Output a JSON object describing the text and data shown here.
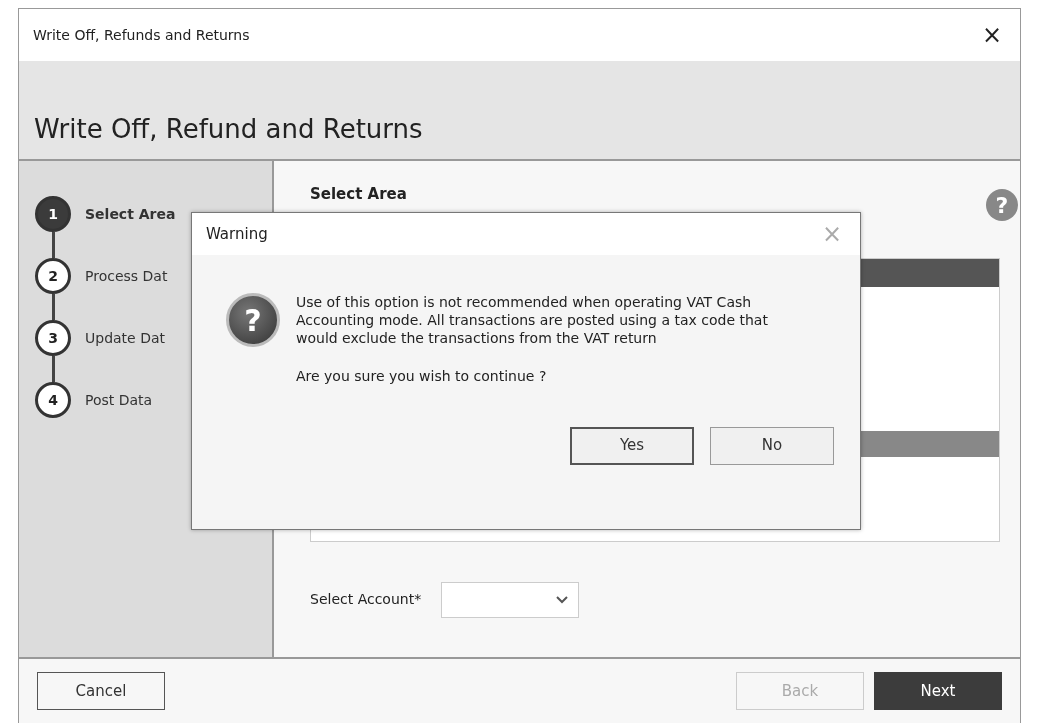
{
  "window": {
    "title": "Write Off, Refunds and Returns",
    "close": "×"
  },
  "header": {
    "title": "Write Off, Refund and Returns"
  },
  "steps": [
    {
      "number": "1",
      "label": "Select Area",
      "selected": true
    },
    {
      "number": "2",
      "label": "Process Dat",
      "selected": false
    },
    {
      "number": "3",
      "label": "Update Dat",
      "selected": false
    },
    {
      "number": "4",
      "label": "Post Data",
      "selected": false
    }
  ],
  "content": {
    "heading": "Select Area",
    "help": "?",
    "account_label": "Select Account*"
  },
  "footer": {
    "buttons": [
      {
        "label": "Cancel",
        "kind": "cancel",
        "disabled": false
      },
      {
        "label": "Back",
        "kind": "back",
        "disabled": true
      },
      {
        "label": "Next",
        "kind": "next",
        "disabled": false
      }
    ]
  },
  "dialog": {
    "title": "Warning",
    "close": "×",
    "icon": "?",
    "message": "Use of this option is not recommended when operating VAT Cash Accounting mode. All transactions are posted using a tax code that would exclude the transactions from the VAT return",
    "question": "Are you sure you wish to continue ?",
    "buttons": [
      {
        "label": "Yes",
        "selected": true
      },
      {
        "label": "No",
        "selected": false
      }
    ]
  }
}
